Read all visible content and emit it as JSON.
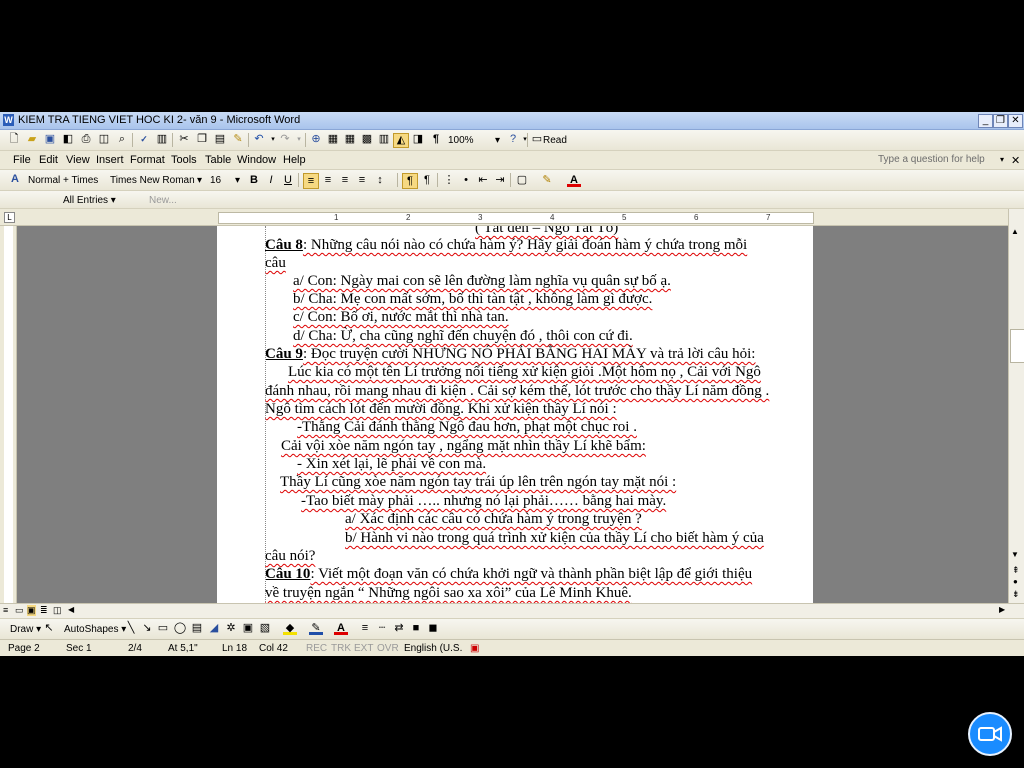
{
  "window": {
    "title": "KIEM TRA TIENG VIET HOC KI 2- văn 9 - Microsoft Word",
    "minimize": "_",
    "restore": "❐",
    "close": "✕"
  },
  "standard_toolbar": {
    "zoom": "100%",
    "read_label": "Read"
  },
  "menu": {
    "items": [
      "File",
      "Edit",
      "View",
      "Insert",
      "Format",
      "Tools",
      "Table",
      "Window",
      "Help"
    ],
    "help_box": "Type a question for help",
    "close_doc": "✕"
  },
  "formatting_toolbar": {
    "style": "Normal + Times",
    "font": "Times New Roman",
    "size": "16",
    "bold": "B",
    "italic": "I",
    "underline": "U"
  },
  "autotext_toolbar": {
    "entries": "All Entries",
    "new": "New..."
  },
  "ruler": {
    "numbers": [
      "1",
      "2",
      "3",
      "4",
      "5",
      "6",
      "7"
    ]
  },
  "document": {
    "lines": [
      {
        "parts": [
          {
            "text": "( Tắt đèn – Ngô Tất Tố)",
            "style": "squig"
          }
        ]
      },
      {
        "parts": [
          {
            "text": "Câu 8",
            "style": "bu"
          },
          {
            "text": ":  Những câu nói nào có chứa hàm ý? Hãy giải đoán hàm ý chứa trong mỗi",
            "style": "squig"
          }
        ]
      },
      {
        "parts": [
          {
            "text": "câu",
            "style": "squig"
          }
        ]
      },
      {
        "parts": [
          {
            "text": "a/ Con: Ngày mai con sẽ lên đường làm nghĩa vụ quân sự bố ạ.",
            "style": "squig"
          }
        ]
      },
      {
        "parts": [
          {
            "text": "b/ Cha: Mẹ con mất sớm, bố thì tàn tật , không làm gì được.",
            "style": "squig"
          }
        ]
      },
      {
        "parts": [
          {
            "text": "c/ Con: Bố ơi, nước mắt thì nhà tan.",
            "style": "squig"
          }
        ]
      },
      {
        "parts": [
          {
            "text": "d/ Cha: Ừ, cha cũng nghĩ đến chuyện đó , thôi con cứ đi.",
            "style": "squig"
          }
        ]
      },
      {
        "parts": [
          {
            "text": "Câu 9",
            "style": "bu"
          },
          {
            "text": ":  Đọc truyện cười NHƯNG NÓ PHẢI BẰNG HAI MÀY và trả lời câu hỏi:",
            "style": "squig"
          }
        ]
      },
      {
        "parts": [
          {
            "text": "Lúc kia có một tên Lí trưởng nổi tiếng xử kiện giỏi .Một hôm nọ , Cải với Ngô",
            "style": "squig"
          }
        ]
      },
      {
        "parts": [
          {
            "text": "đánh nhau, rồi mang nhau đi kiện . Cải sợ kém thế, lót trước cho thầy Lí năm đồng .",
            "style": "squig"
          }
        ]
      },
      {
        "parts": [
          {
            "text": "Ngô tìm cách lót đến mười đồng. Khi xử kiện thầy Lí nói :",
            "style": "squig"
          }
        ]
      },
      {
        "parts": [
          {
            "text": "-Thằng Cải đánh thằng Ngô đau hơn, phạt một chục roi .",
            "style": "squig"
          }
        ]
      },
      {
        "parts": [
          {
            "text": "Cải vội xòe năm ngón tay , ngẩng mặt nhìn thầy Lí khẽ bẩm:",
            "style": "squig"
          }
        ]
      },
      {
        "parts": [
          {
            "text": "- Xin xét lại, lẽ phải về con mà.",
            "style": "squig"
          }
        ]
      },
      {
        "parts": [
          {
            "text": "Thầy Lí cũng xòe năm ngón tay trái úp lên trên ngón tay mặt nói :",
            "style": "squig"
          }
        ]
      },
      {
        "parts": [
          {
            "text": "-Tao biết mày phải ….. nhưng nó lại phải…… bằng hai mày.",
            "style": "squig"
          }
        ]
      },
      {
        "parts": [
          {
            "text": "a/ Xác định các câu có chứa hàm ý trong truyện ?",
            "style": "squig"
          }
        ]
      },
      {
        "parts": [
          {
            "text": "b/ Hành vi nào trong quá trình xử kiện của thầy Lí cho biết hàm ý của",
            "style": "squig"
          }
        ]
      },
      {
        "parts": [
          {
            "text": "câu nói?",
            "style": "squig"
          }
        ]
      },
      {
        "parts": [
          {
            "text": "Câu 10",
            "style": "bu"
          },
          {
            "text": ": Viết một đoạn văn có chứa khởi ngữ và thành phần  biệt lập để giới thiệu",
            "style": "squig"
          }
        ]
      },
      {
        "parts": [
          {
            "text": "về truyện ngắn “ Những ngôi sao xa xôi” của Lê Minh Khuê.",
            "style": "squig"
          }
        ]
      }
    ]
  },
  "drawing_toolbar": {
    "draw": "Draw",
    "autoshapes": "AutoShapes"
  },
  "status_bar": {
    "page": "Page 2",
    "sec": "Sec 1",
    "pages": "2/4",
    "at": "At 5,1\"",
    "ln": "Ln 18",
    "col": "Col 42",
    "rec": "REC",
    "trk": "TRK",
    "ext": "EXT",
    "ovr": "OVR",
    "lang": "English (U.S."
  }
}
